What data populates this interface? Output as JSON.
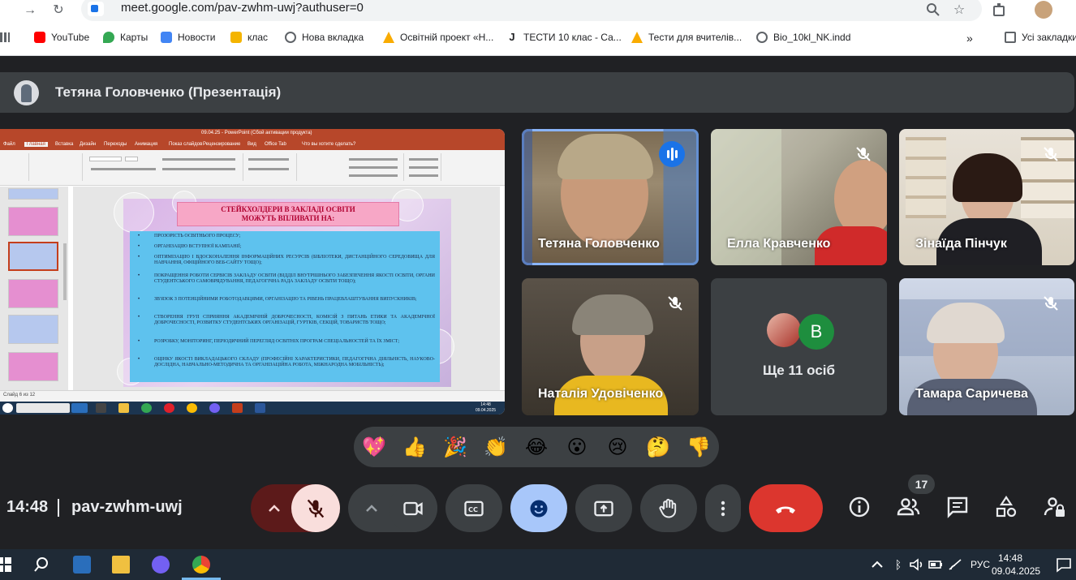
{
  "browser": {
    "url": "meet.google.com/pav-zwhm-uwj?authuser=0",
    "bookmarks": [
      {
        "label": "YouTube",
        "color": "#ff0000"
      },
      {
        "label": "Карты",
        "color": "#34a853"
      },
      {
        "label": "Новости",
        "color": "#4285f4"
      },
      {
        "label": "клас",
        "color": "#f4b400"
      },
      {
        "label": "Нова вкладка",
        "color": "#5f6368"
      },
      {
        "label": "Освітній проект «Н...",
        "color": "#f9ab00"
      },
      {
        "label": "ТЕСТИ 10 клас - Са...",
        "color": "#202124"
      },
      {
        "label": "Тести для вчителів...",
        "color": "#f9ab00"
      },
      {
        "label": "Bio_10kl_NK.indd",
        "color": "#5f6368"
      }
    ],
    "all_bookmarks_label": "Усі закладки"
  },
  "meet": {
    "presenter_title": "Тетяна Головченко (Презентація)",
    "participants": [
      {
        "name": "Тетяна Головченко",
        "speaking": true
      },
      {
        "name": "Елла Кравченко",
        "muted": true
      },
      {
        "name": "Зінаїда Пінчук",
        "muted": true
      },
      {
        "name": "Наталія Удовіченко",
        "muted": true
      },
      {
        "name": "Тамара Саричева",
        "muted": true
      }
    ],
    "more_label": "Ще 11 осіб",
    "more_avatar_letter": "B",
    "time": "14:48",
    "meeting_code": "pav-zwhm-uwj",
    "people_count": "17",
    "reactions": [
      "💖",
      "👍",
      "🎉",
      "👏",
      "😂",
      "😮",
      "😢",
      "🤔",
      "👎"
    ]
  },
  "slide": {
    "ppt_window_title": "09.04.25 - PowerPoint (Сбой активации продукта)",
    "tabs": [
      "Файл",
      "Главная",
      "Вставка",
      "Дизайн",
      "Переходы",
      "Анимация",
      "Показ слайдов",
      "Рецензирование",
      "Вид",
      "Office Tab",
      "Что вы хотите сделать?"
    ],
    "heading_line1": "СТЕЙКХОЛДЕРИ В ЗАКЛАДІ ОСВІТИ",
    "heading_line2": "МОЖУТЬ ВПЛИВАТИ НА:",
    "items": [
      "ПРОЗОРІСТЬ ОСВІТНЬОГО ПРОЦЕСУ;",
      "ОРГАНІЗАЦІЮ ВСТУПНОЇ КАМПАНІЇ;",
      "ОПТИМІЗАЦІЮ І ВДОСКОНАЛЕННЯ ІНФОРМАЦІЙНИХ РЕСУРСІВ (БІБЛІОТЕКИ, ДИСТАНЦІЙНОГО СЕРЕДОВИЩА ДЛЯ НАВЧАННЯ, ОФІЦІЙНОГО ВЕБ-САЙТУ ТОЩО);",
      "ПОКРАЩЕННЯ РОБОТИ СЕРВІСІВ ЗАКЛАДУ ОСВІТИ (ВІДДІЛ ВНУТРІШНЬОГО ЗАБЕЗПЕЧЕННЯ ЯКОСТІ ОСВІТИ, ОРГАНИ СТУДЕНТСЬКОГО САМОВРЯДУВАННЯ, ПЕДАГОГІЧНА РАДА ЗАКЛАДУ ОСВІТИ ТОЩО);",
      "ЗВ'ЯЗОК З ПОТЕНЦІЙНИМИ РОБОТОДАВЦЯМИ, ОРГАНІЗАЦІЮ ТА РІВЕНЬ ПРАЦЕВЛАШТУВАННЯ ВИПУСКНИКІВ;",
      "СТВОРЕННЯ ГРУП СПРИЯННЯ АКАДЕМІЧНІЙ ДОБРОЧЕСНОСТІ, КОМІСІЙ З ПИТАНЬ ЕТИКИ ТА АКАДЕМІЧНОЇ ДОБРОЧЕСНОСТІ, РОЗВИТКУ СТУДЕНТСЬКИХ ОРГАНІЗАЦІЙ, ГУРТКІВ, СЕКЦІЙ, ТОВАРИСТВ ТОЩО;",
      "РОЗРОБКУ, МОНІТОРИНГ, ПЕРІОДИЧНИЙ ПЕРЕГЛЯД ОСВІТНІХ ПРОГРАМ СПЕЦІАЛЬНОСТЕЙ ТА ЇХ ЗМІСТ;",
      "ОЦІНКУ ЯКОСТІ ВИКЛАДАЦЬКОГО СКЛАДУ (ПРОФЕСІЙНІ ХАРАКТЕРИСТИКИ, ПЕДАГОГІЧНА ДІЯЛЬНІСТЬ, НАУКОВО-ДОСЛІДНА, НАВЧАЛЬНО-МЕТОДИЧНА ТА ОРГАНІЗАЦІЙНА РОБОТА, МІЖНАРОДНА МОБІЛЬНІСТЬ);"
    ],
    "status": "Слайд 6 из 12",
    "inner_clock_time": "14:48",
    "inner_clock_date": "09.04.2025"
  },
  "taskbar": {
    "lang": "РУС",
    "time": "14:48",
    "date": "09.04.2025"
  }
}
